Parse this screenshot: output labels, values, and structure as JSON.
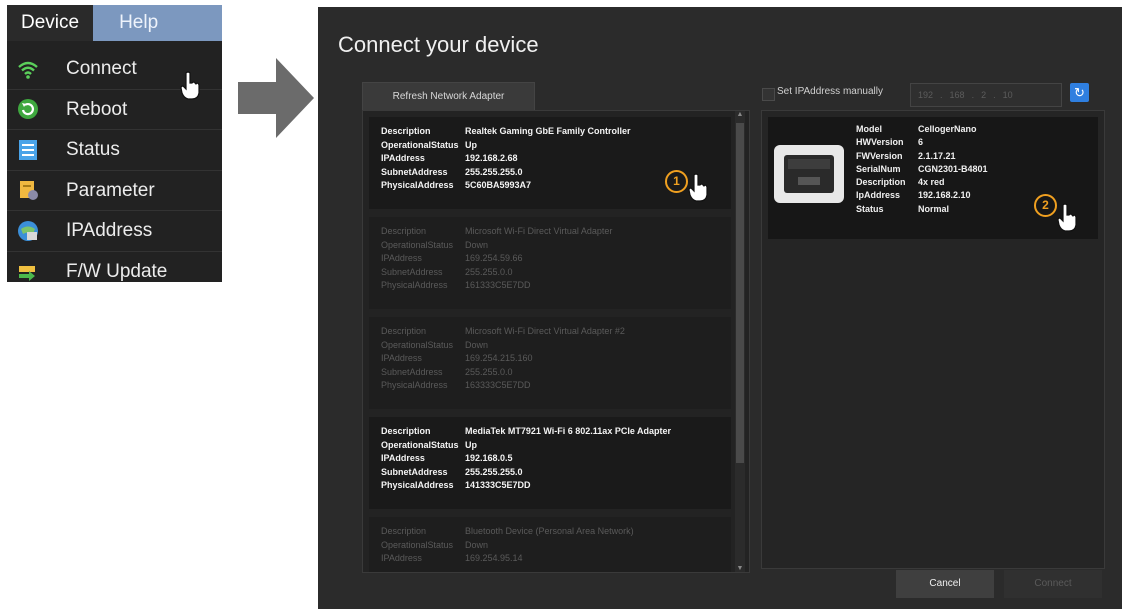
{
  "menu": {
    "tabs": [
      {
        "label": "Device"
      },
      {
        "label": "Help"
      }
    ],
    "items": [
      {
        "label": "Connect",
        "icon": "wifi-icon"
      },
      {
        "label": "Reboot",
        "icon": "reboot-icon"
      },
      {
        "label": "Status",
        "icon": "status-icon"
      },
      {
        "label": "Parameter",
        "icon": "parameter-icon"
      },
      {
        "label": "IPAddress",
        "icon": "ipaddress-icon"
      },
      {
        "label": "F/W Update",
        "icon": "firmware-update-icon"
      }
    ]
  },
  "dialog": {
    "title": "Connect your device",
    "refresh_label": "Refresh Network Adapter",
    "manual_ip_label": "Set IPAddress manually",
    "ip_segments": [
      "192",
      "168",
      "2",
      "10"
    ],
    "adapters": [
      {
        "state": "active",
        "fields": [
          {
            "key": "Description",
            "value": "Realtek Gaming GbE Family Controller"
          },
          {
            "key": "OperationalStatus",
            "value": "Up"
          },
          {
            "key": "IPAddress",
            "value": "192.168.2.68"
          },
          {
            "key": "SubnetAddress",
            "value": "255.255.255.0"
          },
          {
            "key": "PhysicalAddress",
            "value": "5C60BA5993A7"
          }
        ]
      },
      {
        "state": "dim",
        "fields": [
          {
            "key": "Description",
            "value": "Microsoft Wi-Fi Direct Virtual Adapter"
          },
          {
            "key": "OperationalStatus",
            "value": "Down"
          },
          {
            "key": "IPAddress",
            "value": "169.254.59.66"
          },
          {
            "key": "SubnetAddress",
            "value": "255.255.0.0"
          },
          {
            "key": "PhysicalAddress",
            "value": "161333C5E7DD"
          }
        ]
      },
      {
        "state": "dim",
        "fields": [
          {
            "key": "Description",
            "value": "Microsoft Wi-Fi Direct Virtual Adapter #2"
          },
          {
            "key": "OperationalStatus",
            "value": "Down"
          },
          {
            "key": "IPAddress",
            "value": "169.254.215.160"
          },
          {
            "key": "SubnetAddress",
            "value": "255.255.0.0"
          },
          {
            "key": "PhysicalAddress",
            "value": "163333C5E7DD"
          }
        ]
      },
      {
        "state": "active",
        "fields": [
          {
            "key": "Description",
            "value": "MediaTek MT7921 Wi-Fi 6 802.11ax PCIe Adapter"
          },
          {
            "key": "OperationalStatus",
            "value": "Up"
          },
          {
            "key": "IPAddress",
            "value": "192.168.0.5"
          },
          {
            "key": "SubnetAddress",
            "value": "255.255.255.0"
          },
          {
            "key": "PhysicalAddress",
            "value": "141333C5E7DD"
          }
        ]
      },
      {
        "state": "dim",
        "fields": [
          {
            "key": "Description",
            "value": "Bluetooth Device (Personal Area Network)"
          },
          {
            "key": "OperationalStatus",
            "value": "Down"
          },
          {
            "key": "IPAddress",
            "value": "169.254.95.14"
          }
        ]
      }
    ],
    "device": {
      "fields": [
        {
          "key": "Model",
          "value": "CellogerNano"
        },
        {
          "key": "HWVersion",
          "value": "6"
        },
        {
          "key": "FWVersion",
          "value": "2.1.17.21"
        },
        {
          "key": "SerialNum",
          "value": "CGN2301-B4801"
        },
        {
          "key": "Description",
          "value": "4x red"
        },
        {
          "key": "IpAddress",
          "value": "192.168.2.10"
        },
        {
          "key": "Status",
          "value": "Normal"
        }
      ]
    },
    "cancel_label": "Cancel",
    "connect_label": "Connect"
  },
  "markers": [
    "1",
    "2"
  ],
  "colors": {
    "accent_blue": "#2f7fe0",
    "marker_orange": "#f0a020",
    "help_tab": "#7c98bf"
  }
}
